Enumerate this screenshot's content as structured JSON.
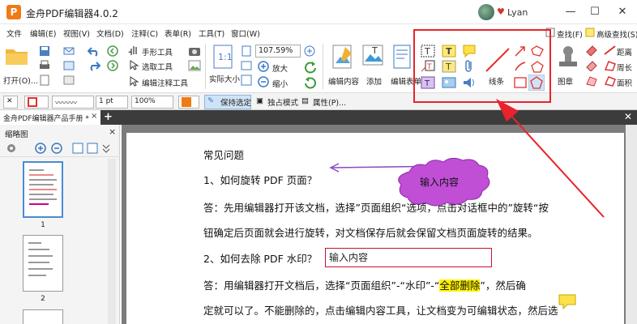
{
  "titlebar": {
    "logo_letter": "P",
    "title": "金舟PDF编辑器4.0.2",
    "user_name": "Lyan",
    "minimize": "—",
    "maximize": "☐",
    "close": "✕"
  },
  "menu": {
    "items": [
      "文件",
      "编辑(E)",
      "视图(V)",
      "文档(D)",
      "注释(C)",
      "表单(R)",
      "工具(T)",
      "窗口(W)"
    ],
    "right": {
      "find": "查找(F)",
      "advanced_find": "高级查找(S)"
    }
  },
  "ribbon": {
    "open_label": "打开(O)...",
    "hand_tool": "手形工具",
    "select_tool": "选取工具",
    "edit_annot_tool": "编辑注释工具",
    "actual_size": "实际大小",
    "zoom_value": "107.59%",
    "zoom_in": "放大",
    "zoom_out": "缩小",
    "edit_content": "编辑内容",
    "add": "添加",
    "edit_form": "编辑表单",
    "line": "线条",
    "stamp": "图章",
    "distance": "距离",
    "perimeter": "周长",
    "area": "面积"
  },
  "propbar": {
    "width_value": "1 pt",
    "opacity_value": "100%",
    "keep_selected": "保持选定",
    "exclusive_mode": "独占模式",
    "properties": "属性(P)..."
  },
  "tabs": {
    "doc_tab": "金舟PDF编辑器产品手册 *",
    "close_tab": "×",
    "add_tab": "+",
    "close_all": "✕"
  },
  "thumbnails": {
    "title": "缩略图",
    "close": "×",
    "pages": [
      "1",
      "2"
    ]
  },
  "document": {
    "lines": [
      "常见问题",
      "1、如何旋转 PDF 页面？",
      "答：先用编辑器打开该文档，选择”页面组织“选项，点击对话框中的”旋转“按",
      "钮确定后页面就会进行旋转，对文档保存后就会保留文档页面旋转的结果。",
      "2、如何去除 PDF 水印？",
      "答：用编辑器打开文档后，选择“页面组织”-“水印”-“",
      "定就可以了。不能删除的，点击编辑内容工具，让文档变为可编辑状态，然后选"
    ],
    "highlight_text": "全部删除",
    "line6_suffix": "”，然后确",
    "cloud_text": "输入内容",
    "textbox_text": "输入内容"
  },
  "colors": {
    "accent_red": "#e8232b",
    "cloud_fill": "#c04fd6",
    "highlight": "#fff200"
  }
}
